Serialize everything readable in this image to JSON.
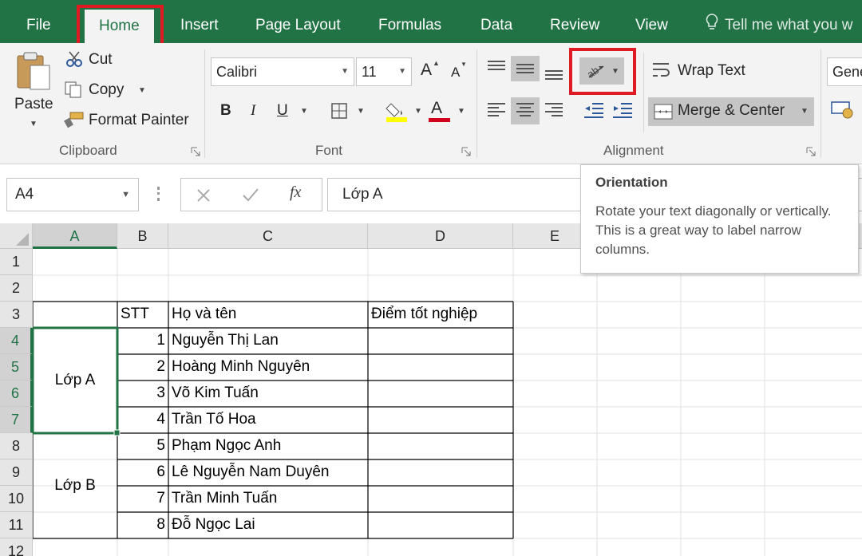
{
  "ribbon_tabs": [
    "File",
    "Home",
    "Insert",
    "Page Layout",
    "Formulas",
    "Data",
    "Review",
    "View"
  ],
  "active_tab": "Home",
  "tell_me": "Tell me what you w",
  "clipboard": {
    "paste": "Paste",
    "cut": "Cut",
    "copy": "Copy",
    "format_painter": "Format Painter",
    "group_label": "Clipboard"
  },
  "font": {
    "font_name": "Calibri",
    "font_size": "11",
    "bold": "B",
    "italic": "I",
    "underline": "U",
    "font_color_glyph": "A",
    "grow_glyph": "A",
    "shrink_glyph": "A",
    "group_label": "Font"
  },
  "alignment": {
    "wrap_text": "Wrap Text",
    "merge_center": "Merge & Center",
    "group_label": "Alignment"
  },
  "number": {
    "format": "Gene"
  },
  "formula_bar": {
    "name_box": "A4",
    "fx": "fx",
    "value": "Lớp A"
  },
  "tooltip": {
    "title": "Orientation",
    "body": "Rotate your text diagonally or vertically. This is a great way to label narrow columns."
  },
  "columns": [
    "A",
    "B",
    "C",
    "D",
    "E"
  ],
  "rows": [
    "1",
    "2",
    "3",
    "4",
    "5",
    "6",
    "7",
    "8",
    "9",
    "10",
    "11",
    "12"
  ],
  "table": {
    "header": {
      "stt": "STT",
      "name": "Họ và tên",
      "score": "Điểm tốt nghiệp"
    },
    "groups": [
      "Lớp A",
      "Lớp B"
    ],
    "students": [
      {
        "stt": "1",
        "name": "Nguyễn Thị Lan"
      },
      {
        "stt": "2",
        "name": "Hoàng Minh Nguyên"
      },
      {
        "stt": "3",
        "name": "Võ Kim Tuấn"
      },
      {
        "stt": "4",
        "name": "Trần Tố Hoa"
      },
      {
        "stt": "5",
        "name": "Phạm Ngọc Anh"
      },
      {
        "stt": "6",
        "name": "Lê Nguyễn Nam Duyên"
      },
      {
        "stt": "7",
        "name": "Trần Minh Tuấn"
      },
      {
        "stt": "8",
        "name": "Đỗ Ngọc Lai"
      }
    ]
  },
  "colors": {
    "excel_green": "#217346",
    "highlight_red": "#e01a22"
  }
}
